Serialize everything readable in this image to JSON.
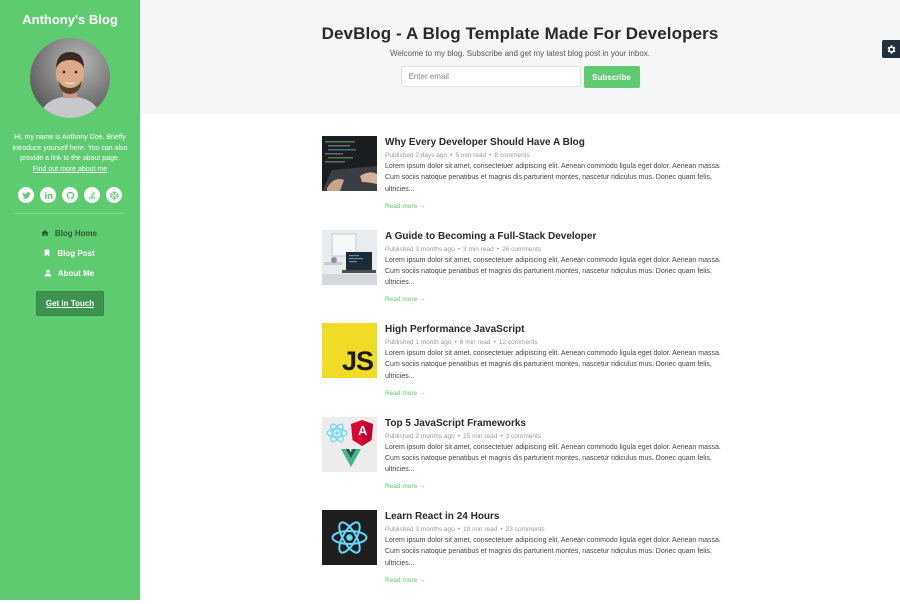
{
  "sidebar": {
    "blog_name": "Anthony's Blog",
    "bio": "Hi, my name is Anthony Doe. Briefly introduce yourself here. You can also provide a link to the about page.",
    "bio_link": "Find out more about me",
    "social": [
      {
        "name": "twitter-icon"
      },
      {
        "name": "linkedin-icon"
      },
      {
        "name": "github-icon"
      },
      {
        "name": "stack-overflow-icon"
      },
      {
        "name": "codepen-icon"
      }
    ],
    "nav": [
      {
        "label": "Blog Home",
        "icon": "home-icon",
        "active": true
      },
      {
        "label": "Blog Post",
        "icon": "bookmark-icon",
        "active": false
      },
      {
        "label": "About Me",
        "icon": "user-icon",
        "active": false
      }
    ],
    "cta_label": "Get in Touch"
  },
  "hero": {
    "title": "DevBlog - A Blog Template Made For Developers",
    "subtitle": "Welcome to my blog. Subscribe and get my latest blog post in your inbox.",
    "email_placeholder": "Enter email",
    "email_value": "",
    "subscribe_label": "Subscribe"
  },
  "colors": {
    "accent": "#5fcb71",
    "accent_dark": "#3d9250",
    "hero_bg": "#f5f6f7",
    "gear_bg": "#22303e"
  },
  "posts": [
    {
      "title": "Why Every Developer Should Have A Blog",
      "published": "Published 2 days ago",
      "read_time": "5 min read",
      "comments": "8 comments",
      "excerpt": "Lorem ipsum dolor sit amet, consectetuer adipiscing elit. Aenean commodo ligula eget dolor. Aenean massa. Cum sociis natoque penatibus et magnis dis parturient montes, nascetur ridiculus mus. Donec quam felis, ultricies...",
      "read_more": "Read more →",
      "thumb": "laptop-code"
    },
    {
      "title": "A Guide to Becoming a Full-Stack Developer",
      "published": "Published 3 months ago",
      "read_time": "3 min read",
      "comments": "26 comments",
      "excerpt": "Lorem ipsum dolor sit amet, consectetuer adipiscing elit. Aenean commodo ligula eget dolor. Aenean massa. Cum sociis natoque penatibus et magnis dis parturient montes, nascetur ridiculus mus. Donec quam felis, ultricies...",
      "read_more": "Read more →",
      "thumb": "workstation"
    },
    {
      "title": "High Performance JavaScript",
      "published": "Published 1 month ago",
      "read_time": "8 min read",
      "comments": "12 comments",
      "excerpt": "Lorem ipsum dolor sit amet, consectetuer adipiscing elit. Aenean commodo ligula eget dolor. Aenean massa. Cum sociis natoque penatibus et magnis dis parturient montes, nascetur ridiculus mus. Donec quam felis, ultricies...",
      "read_more": "Read more →",
      "thumb": "js-logo",
      "thumb_text": "JS"
    },
    {
      "title": "Top 5 JavaScript Frameworks",
      "published": "Published 2 months ago",
      "read_time": "15 min read",
      "comments": "3 comments",
      "excerpt": "Lorem ipsum dolor sit amet, consectetuer adipiscing elit. Aenean commodo ligula eget dolor. Aenean massa. Cum sociis natoque penatibus et magnis dis parturient montes, nascetur ridiculus mus. Donec quam felis, ultricies...",
      "read_more": "Read more →",
      "thumb": "frameworks",
      "thumb_text": "A"
    },
    {
      "title": "Learn React in 24 Hours",
      "published": "Published 3 months ago",
      "read_time": "10 min read",
      "comments": "23 comments",
      "excerpt": "Lorem ipsum dolor sit amet, consectetuer adipiscing elit. Aenean commodo ligula eget dolor. Aenean massa. Cum sociis natoque penatibus et magnis dis parturient montes, nascetur ridiculus mus. Donec quam felis, ultricies...",
      "read_more": "Read more →",
      "thumb": "react-logo"
    }
  ]
}
